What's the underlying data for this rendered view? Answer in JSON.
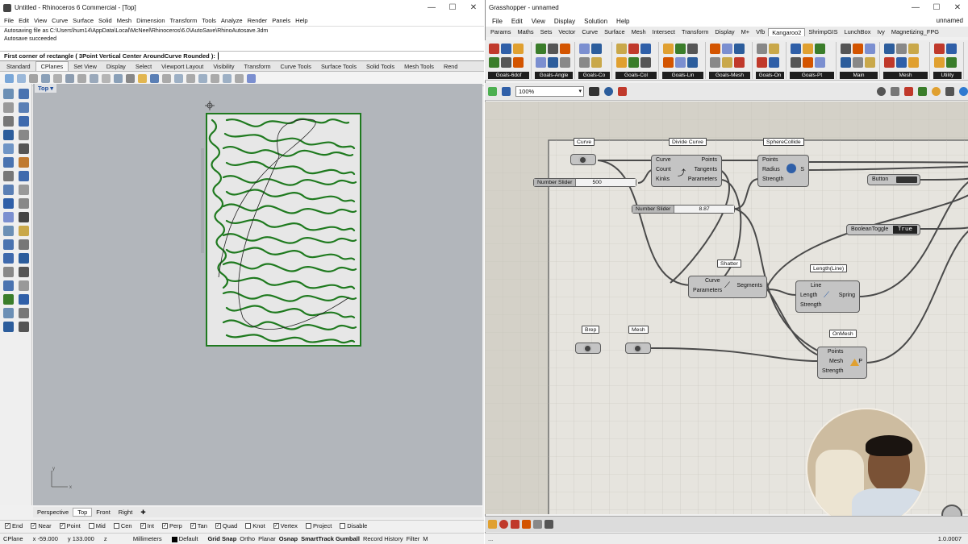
{
  "rhino": {
    "title": "Untitled - Rhinoceros 6 Commercial - [Top]",
    "menu": [
      "File",
      "Edit",
      "View",
      "Curve",
      "Surface",
      "Solid",
      "Mesh",
      "Dimension",
      "Transform",
      "Tools",
      "Analyze",
      "Render",
      "Panels",
      "Help"
    ],
    "command_history": [
      "Autosaving file as C:\\Users\\hum14\\AppData\\Local\\McNeel\\Rhinoceros\\6.0\\AutoSave\\RhinoAutosave.3dm",
      "Autosave succeeded"
    ],
    "prompt": "First corner of rectangle ( 3Point  Vertical  Center  AroundCurve  Rounded ):",
    "tabs": [
      "Standard",
      "CPlanes",
      "Set View",
      "Display",
      "Select",
      "Viewport Layout",
      "Visibility",
      "Transform",
      "Curve Tools",
      "Surface Tools",
      "Solid Tools",
      "Mesh Tools",
      "Rend"
    ],
    "active_tab": "CPlanes",
    "viewport_label": "Top",
    "viewport_tabs": [
      "Perspective",
      "Top",
      "Front",
      "Right"
    ],
    "osnaps": [
      {
        "label": "End",
        "checked": true
      },
      {
        "label": "Near",
        "checked": true
      },
      {
        "label": "Point",
        "checked": true
      },
      {
        "label": "Mid",
        "checked": false
      },
      {
        "label": "Cen",
        "checked": false
      },
      {
        "label": "Int",
        "checked": true
      },
      {
        "label": "Perp",
        "checked": true
      },
      {
        "label": "Tan",
        "checked": true
      },
      {
        "label": "Quad",
        "checked": true
      },
      {
        "label": "Knot",
        "checked": false
      },
      {
        "label": "Vertex",
        "checked": true
      },
      {
        "label": "Project",
        "checked": false
      },
      {
        "label": "Disable",
        "checked": false
      }
    ],
    "status": {
      "cplane": "CPlane",
      "x": "x -59.000",
      "y": "y 133.000",
      "z": "z",
      "units": "Millimeters",
      "layer": "Default",
      "toggles": [
        "Grid Snap",
        "Ortho",
        "Planar",
        "Osnap",
        "SmartTrack",
        "Gumball",
        "Record History",
        "Filter",
        "M"
      ]
    },
    "axis_x": "x",
    "axis_y": "y"
  },
  "gh": {
    "title": "Grasshopper - unnamed",
    "menu": [
      "File",
      "Edit",
      "View",
      "Display",
      "Solution",
      "Help"
    ],
    "doc_name": "unnamed",
    "tabs": [
      "Params",
      "Maths",
      "Sets",
      "Vector",
      "Curve",
      "Surface",
      "Mesh",
      "Intersect",
      "Transform",
      "Display",
      "M+",
      "Vfb",
      "Kangaroo2",
      "ShrimpGIS",
      "LunchBox",
      "Ivy",
      "Magnetizing_FPG"
    ],
    "active_tab": "Kangaroo2",
    "ribbon_groups": [
      "Goals-6dof",
      "Goals-Angle",
      "Goals-Co",
      "Goals-Col",
      "Goals-Lin",
      "Goals-Mesh",
      "Goals-On",
      "Goals-Pt",
      "Main",
      "Mesh",
      "Utility"
    ],
    "zoom": "100%",
    "version": "1.0.0007",
    "nodes": {
      "curve_param": "Curve",
      "divide": {
        "title": "Divide Curve",
        "inputs": [
          "Curve",
          "Count",
          "Kinks"
        ],
        "outputs": [
          "Points",
          "Tangents",
          "Parameters"
        ]
      },
      "sphere": {
        "title": "SphereCollide",
        "inputs": [
          "Points",
          "Radius",
          "Strength"
        ],
        "output": "S"
      },
      "slider1": {
        "name": "Number Slider",
        "value": "500"
      },
      "slider2": {
        "name": "Number Slider",
        "value": "8.87"
      },
      "button": "Button",
      "toggle": {
        "name": "BooleanToggle",
        "value": "True"
      },
      "shatter": {
        "title": "Shatter",
        "inputs": [
          "Curve",
          "Parameters"
        ],
        "output": "Segments"
      },
      "length": {
        "title": "Length(Line)",
        "inputs": [
          "Line",
          "Length",
          "Strength"
        ],
        "output": "Spring"
      },
      "brep": "Brep",
      "mesh": "Mesh",
      "onmesh": {
        "title": "OnMesh",
        "inputs": [
          "Points",
          "Mesh",
          "Strength"
        ],
        "output": "P"
      }
    }
  },
  "colors": {
    "curve_green": "#1f7a1f",
    "canvas": "#d4d1c8",
    "viewport": "#b2b6bb"
  }
}
